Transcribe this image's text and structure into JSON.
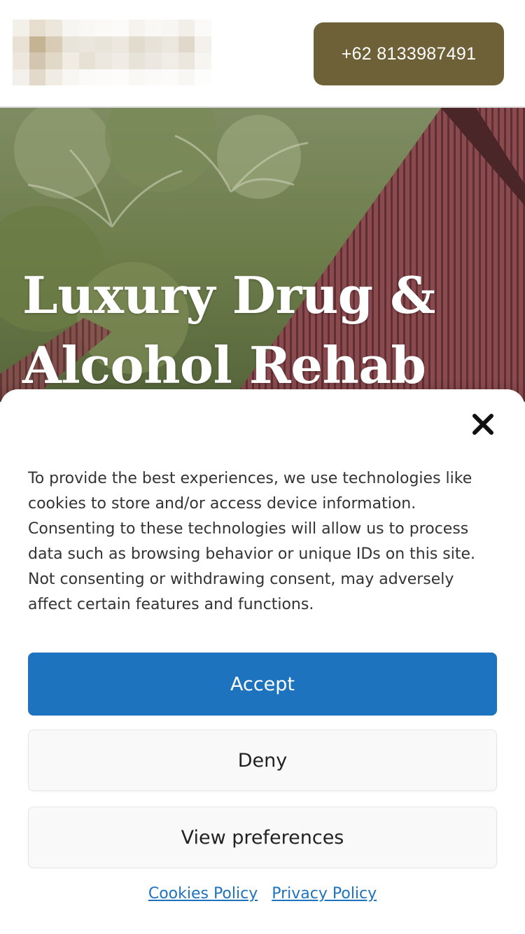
{
  "header": {
    "logo_name": "blurred-logo",
    "phone": "+62 8133987491",
    "phone_button_color": "#6e6138"
  },
  "hero": {
    "title_line1": "Luxury Drug &",
    "title_line2": "Alcohol Rehab"
  },
  "consent": {
    "message": "To provide the best experiences, we use technologies like cookies to store and/or access device information. Consenting to these technologies will allow us to process data such as browsing behavior or unique IDs on this site. Not consenting or withdrawing consent, may adversely affect certain features and functions.",
    "close_icon": "close-icon",
    "accept_label": "Accept",
    "deny_label": "Deny",
    "preferences_label": "View preferences",
    "cookies_policy_label": "Cookies Policy",
    "privacy_policy_label": "Privacy Policy",
    "accent_color": "#1e73be"
  }
}
